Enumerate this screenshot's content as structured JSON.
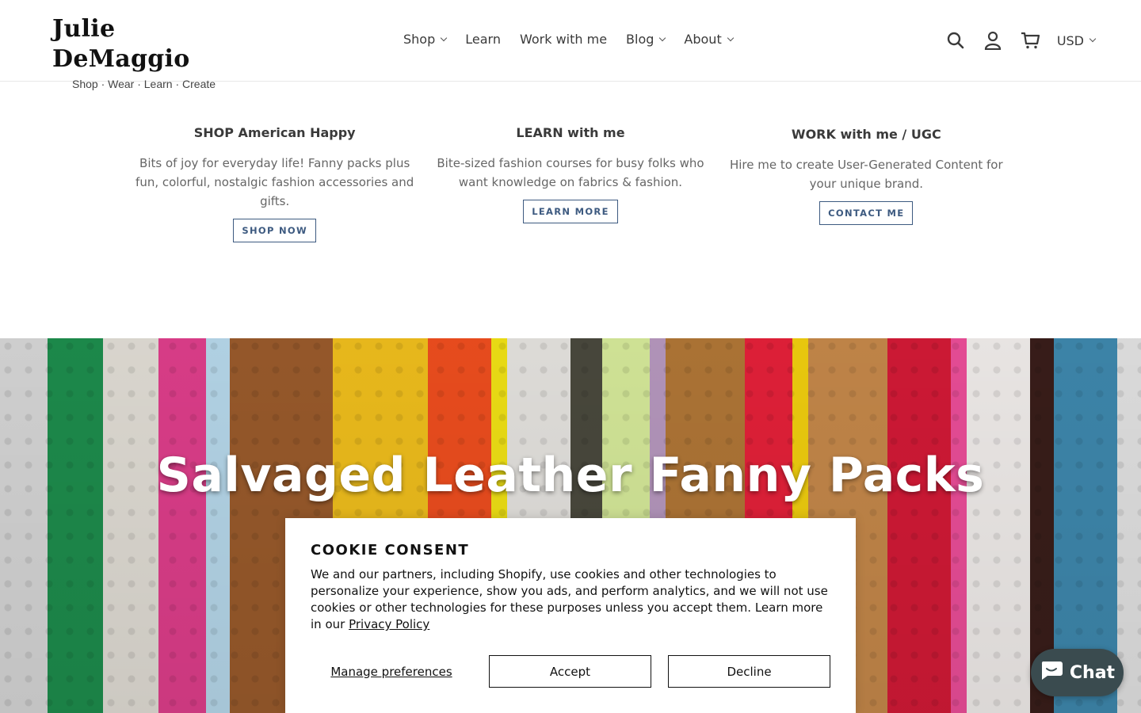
{
  "header": {
    "logo_title": "Julie DeMaggio",
    "logo_tagline": "Shop · Wear · Learn · Create",
    "nav": [
      {
        "label": "Shop",
        "dropdown": true
      },
      {
        "label": "Learn",
        "dropdown": false
      },
      {
        "label": "Work with me",
        "dropdown": false
      },
      {
        "label": "Blog",
        "dropdown": true
      },
      {
        "label": "About",
        "dropdown": true
      }
    ],
    "icons": [
      "search-icon",
      "account-icon",
      "cart-icon"
    ],
    "currency": "USD"
  },
  "features": [
    {
      "title": "SHOP American Happy",
      "text": "Bits of joy for everyday life! Fanny packs plus fun, colorful, nostalgic fashion accessories and gifts.",
      "button": "SHOP NOW"
    },
    {
      "title": "LEARN with me",
      "text": "Bite-sized fashion courses for busy folks who want knowledge on fabrics & fashion.",
      "button": "LEARN MORE"
    },
    {
      "title": "WORK with me / UGC",
      "text": "Hire me to create User-Generated Content for your unique brand.",
      "button": "CONTACT ME"
    }
  ],
  "hero": {
    "title": "Salvaged Leather Fanny Packs"
  },
  "cookie": {
    "title": "COOKIE CONSENT",
    "text": "We and our partners, including Shopify, use cookies and other technologies to personalize your experience, show you ads, and perform analytics, and we will not use cookies or other technologies for these purposes unless you accept them. Learn more in our",
    "link": "Privacy Policy",
    "manage": "Manage preferences",
    "accept": "Accept",
    "decline": "Decline"
  },
  "chat": {
    "label": "Chat"
  },
  "colors": {
    "button_border": "#3d5a80",
    "chat_bg": "#3a4b4f"
  }
}
